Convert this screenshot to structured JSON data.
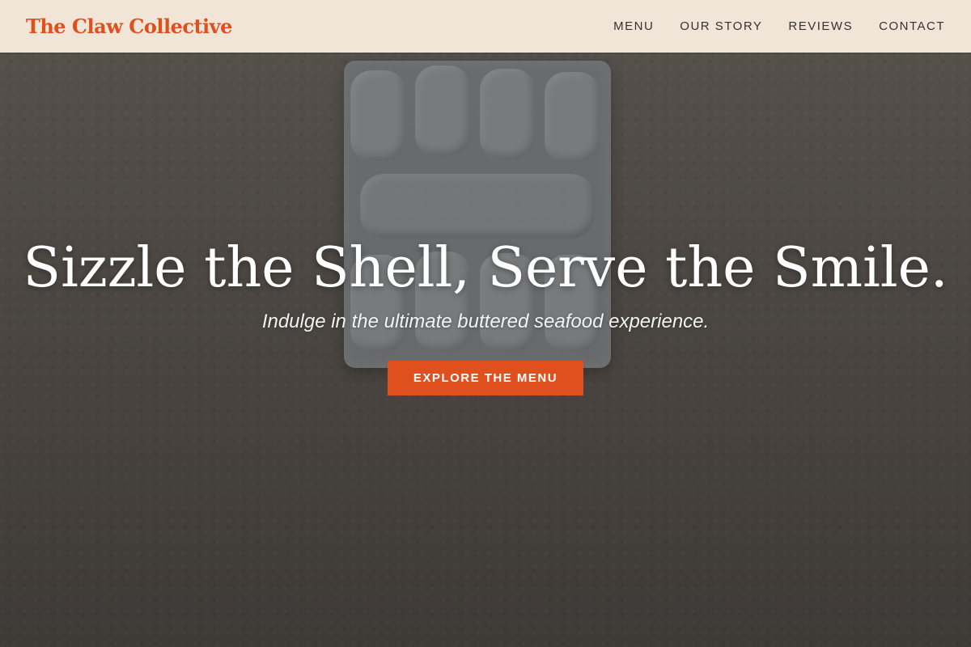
{
  "header": {
    "brand": "The Claw Collective",
    "nav": [
      {
        "label": "MENU"
      },
      {
        "label": "OUR STORY"
      },
      {
        "label": "REVIEWS"
      },
      {
        "label": "CONTACT"
      }
    ]
  },
  "hero": {
    "headline": "Sizzle the Shell, Serve the Smile.",
    "subheadline": "Indulge in the ultimate buttered seafood experience.",
    "cta_label": "EXPLORE THE MENU"
  },
  "colors": {
    "accent": "#e0501f",
    "nav_background": "#f0e5d7"
  }
}
